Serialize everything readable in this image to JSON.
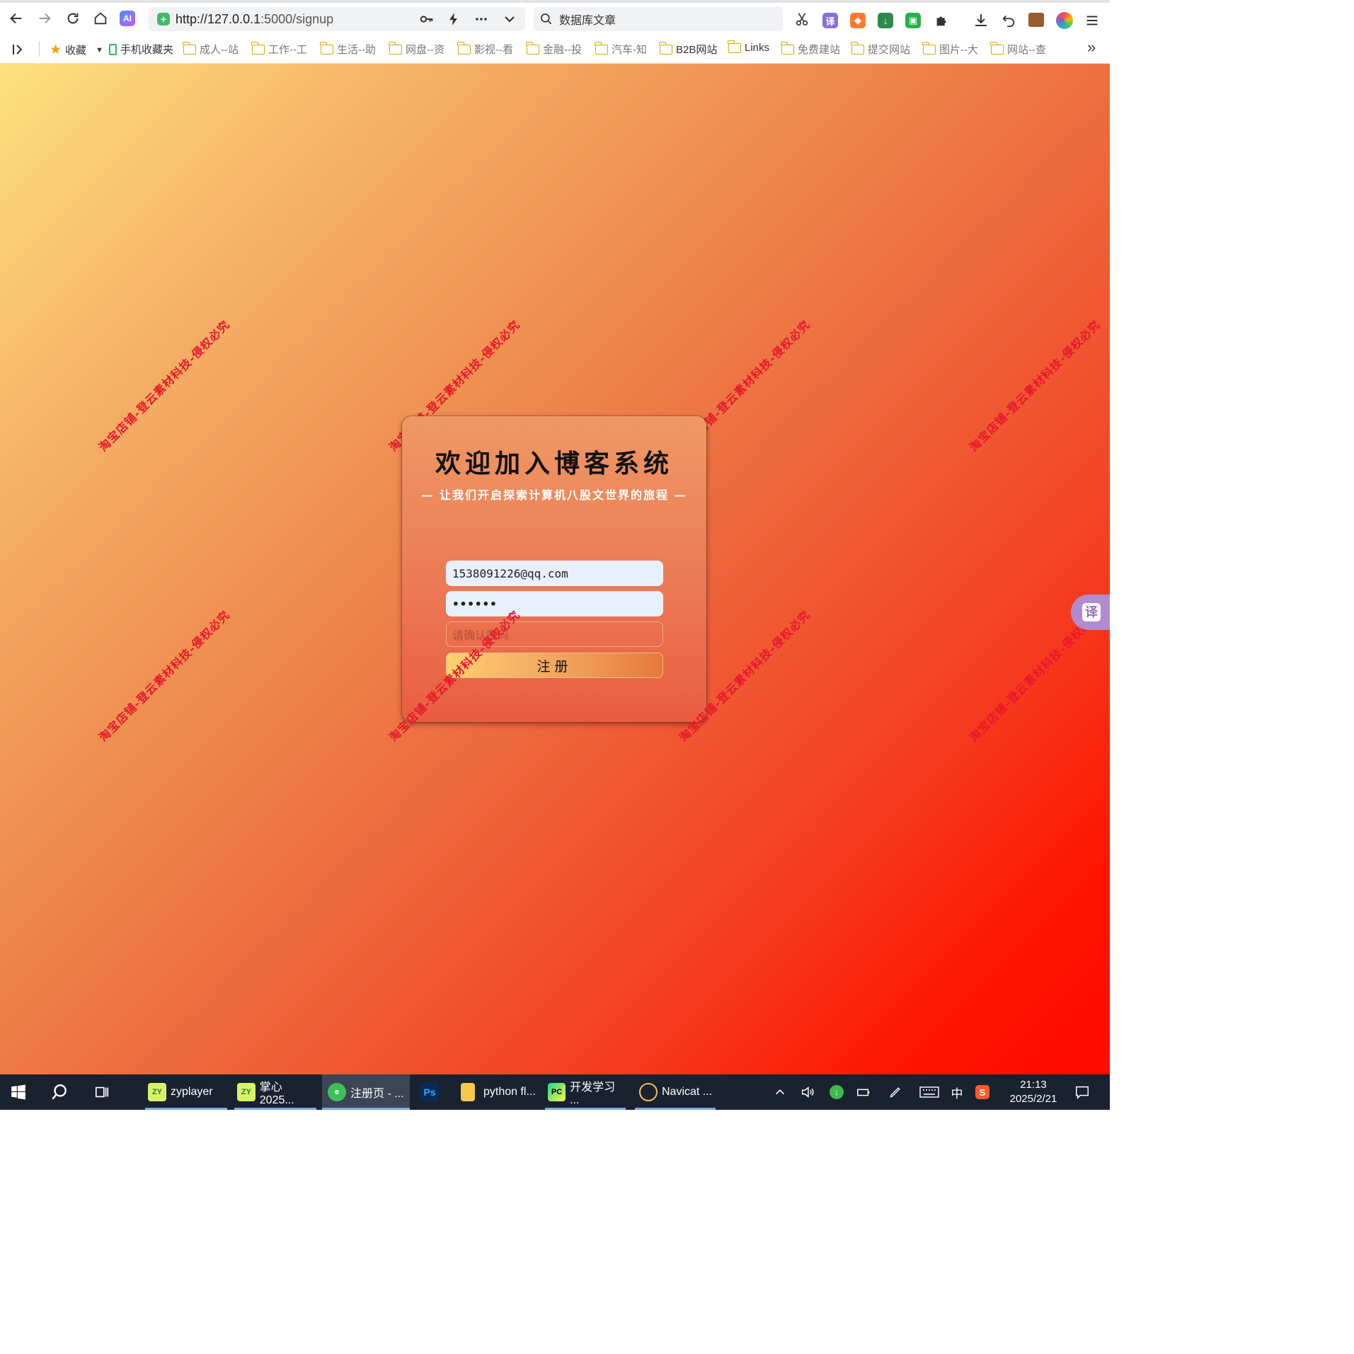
{
  "browser": {
    "url_host": "http://127.0.0.1",
    "url_rest": ":5000/signup",
    "search_text": "数据库文章"
  },
  "bookmarks": {
    "items": [
      "收藏",
      "手机收藏夹",
      "成人--站",
      "工作--工",
      "生活--助",
      "网盘--资",
      "影视--看",
      "金融--投",
      "汽车-知",
      "B2B网站",
      "Links",
      "免费建站",
      "提交网站",
      "图片--大",
      "网站--查"
    ],
    "more": "»"
  },
  "page": {
    "title": "欢迎加入博客系统",
    "subtitle": "— 让我们开启探索计算机八股文世界的旅程 —",
    "email_value": "1538091226@qq.com",
    "password_value": "••••••",
    "confirm_placeholder": "请确认密码",
    "submit_label": "注册",
    "watermark": "淘宝店铺-登云素材科技-侵权必究",
    "translate_label": "译"
  },
  "taskbar": {
    "apps": [
      "zyplayer",
      "掌心2025...",
      "注册页 - ...",
      "Ps",
      "python fl...",
      "开发学习 ...",
      "Navicat ..."
    ],
    "ime": "中",
    "time": "21:13",
    "date": "2025/2/21"
  }
}
